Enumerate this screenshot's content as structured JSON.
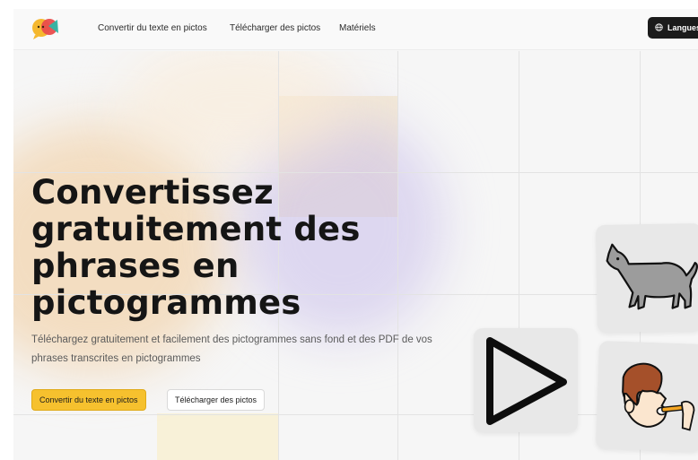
{
  "nav": {
    "links": [
      "Convertir du texte en pictos",
      "Télécharger des pictos",
      "Matériels"
    ],
    "language_button": "Langues"
  },
  "hero": {
    "title_lines": [
      "Convertissez",
      "gratuitement des",
      "phrases en",
      "pictogrammes"
    ],
    "subtitle": "Téléchargez gratuitement et facilement des pictogrammes sans fond et des PDF de vos phrases transcrites en pictogrammes",
    "primary_button": "Convertir du texte en pictos",
    "secondary_button": "Télécharger des pictos"
  },
  "icons": {
    "logo": "speech-bubbles-logo-icon",
    "language": "globe-icon",
    "cards": [
      "cat-pictogram-icon",
      "play-triangle-icon",
      "brushing-teeth-pictogram-icon"
    ]
  },
  "colors": {
    "accent": "#f6c12e",
    "dark": "#1b1b1b",
    "logo_yellow": "#f5b82e",
    "logo_red": "#e94c4c",
    "logo_teal": "#2fb7a6"
  }
}
